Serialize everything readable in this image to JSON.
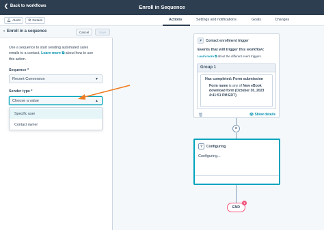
{
  "header": {
    "back_label": "Back to workflows",
    "title": "Enroll in Sequence"
  },
  "subbar": {
    "alerts_label": "Alerts",
    "details_label": "Details",
    "tabs": [
      "Actions",
      "Settings and notifications",
      "Goals",
      "Changes"
    ]
  },
  "panel": {
    "title": "Enroll in a sequence",
    "cancel_label": "Cancel",
    "save_label": "Save",
    "desc_pre": "Use a sequence to start sending automated sales emails to a contact.",
    "desc_link": "Learn more",
    "desc_post": "about how to use this action.",
    "sequence_label": "Sequence *",
    "sequence_value": "Recent Conversion",
    "sender_label": "Sender type *",
    "sender_placeholder": "Choose a value",
    "sender_options": [
      "Specific user",
      "Contact owner"
    ]
  },
  "trigger_card": {
    "header": "Contact enrollment trigger",
    "subtitle": "Events that will trigger this workflow:",
    "learn_link": "Learn more",
    "learn_rest": "about the different event triggers.",
    "group_title": "Group 1",
    "criteria_title": "Has completed: Form submission",
    "criteria_field": "Form name",
    "criteria_op": "is any of",
    "criteria_value": "New eBook download form (October 30, 2023 4:41:51 PM EDT)",
    "show_details": "Show details"
  },
  "action_card": {
    "header": "Configuring",
    "body": "Configuring..."
  },
  "end": {
    "label": "END",
    "badge": "1"
  },
  "colors": {
    "header_bg": "#2d3e50",
    "accent_teal": "#00a4bd",
    "link": "#0091ae",
    "annotation_arrow": "#f07c22",
    "end_border": "#f2547d"
  }
}
